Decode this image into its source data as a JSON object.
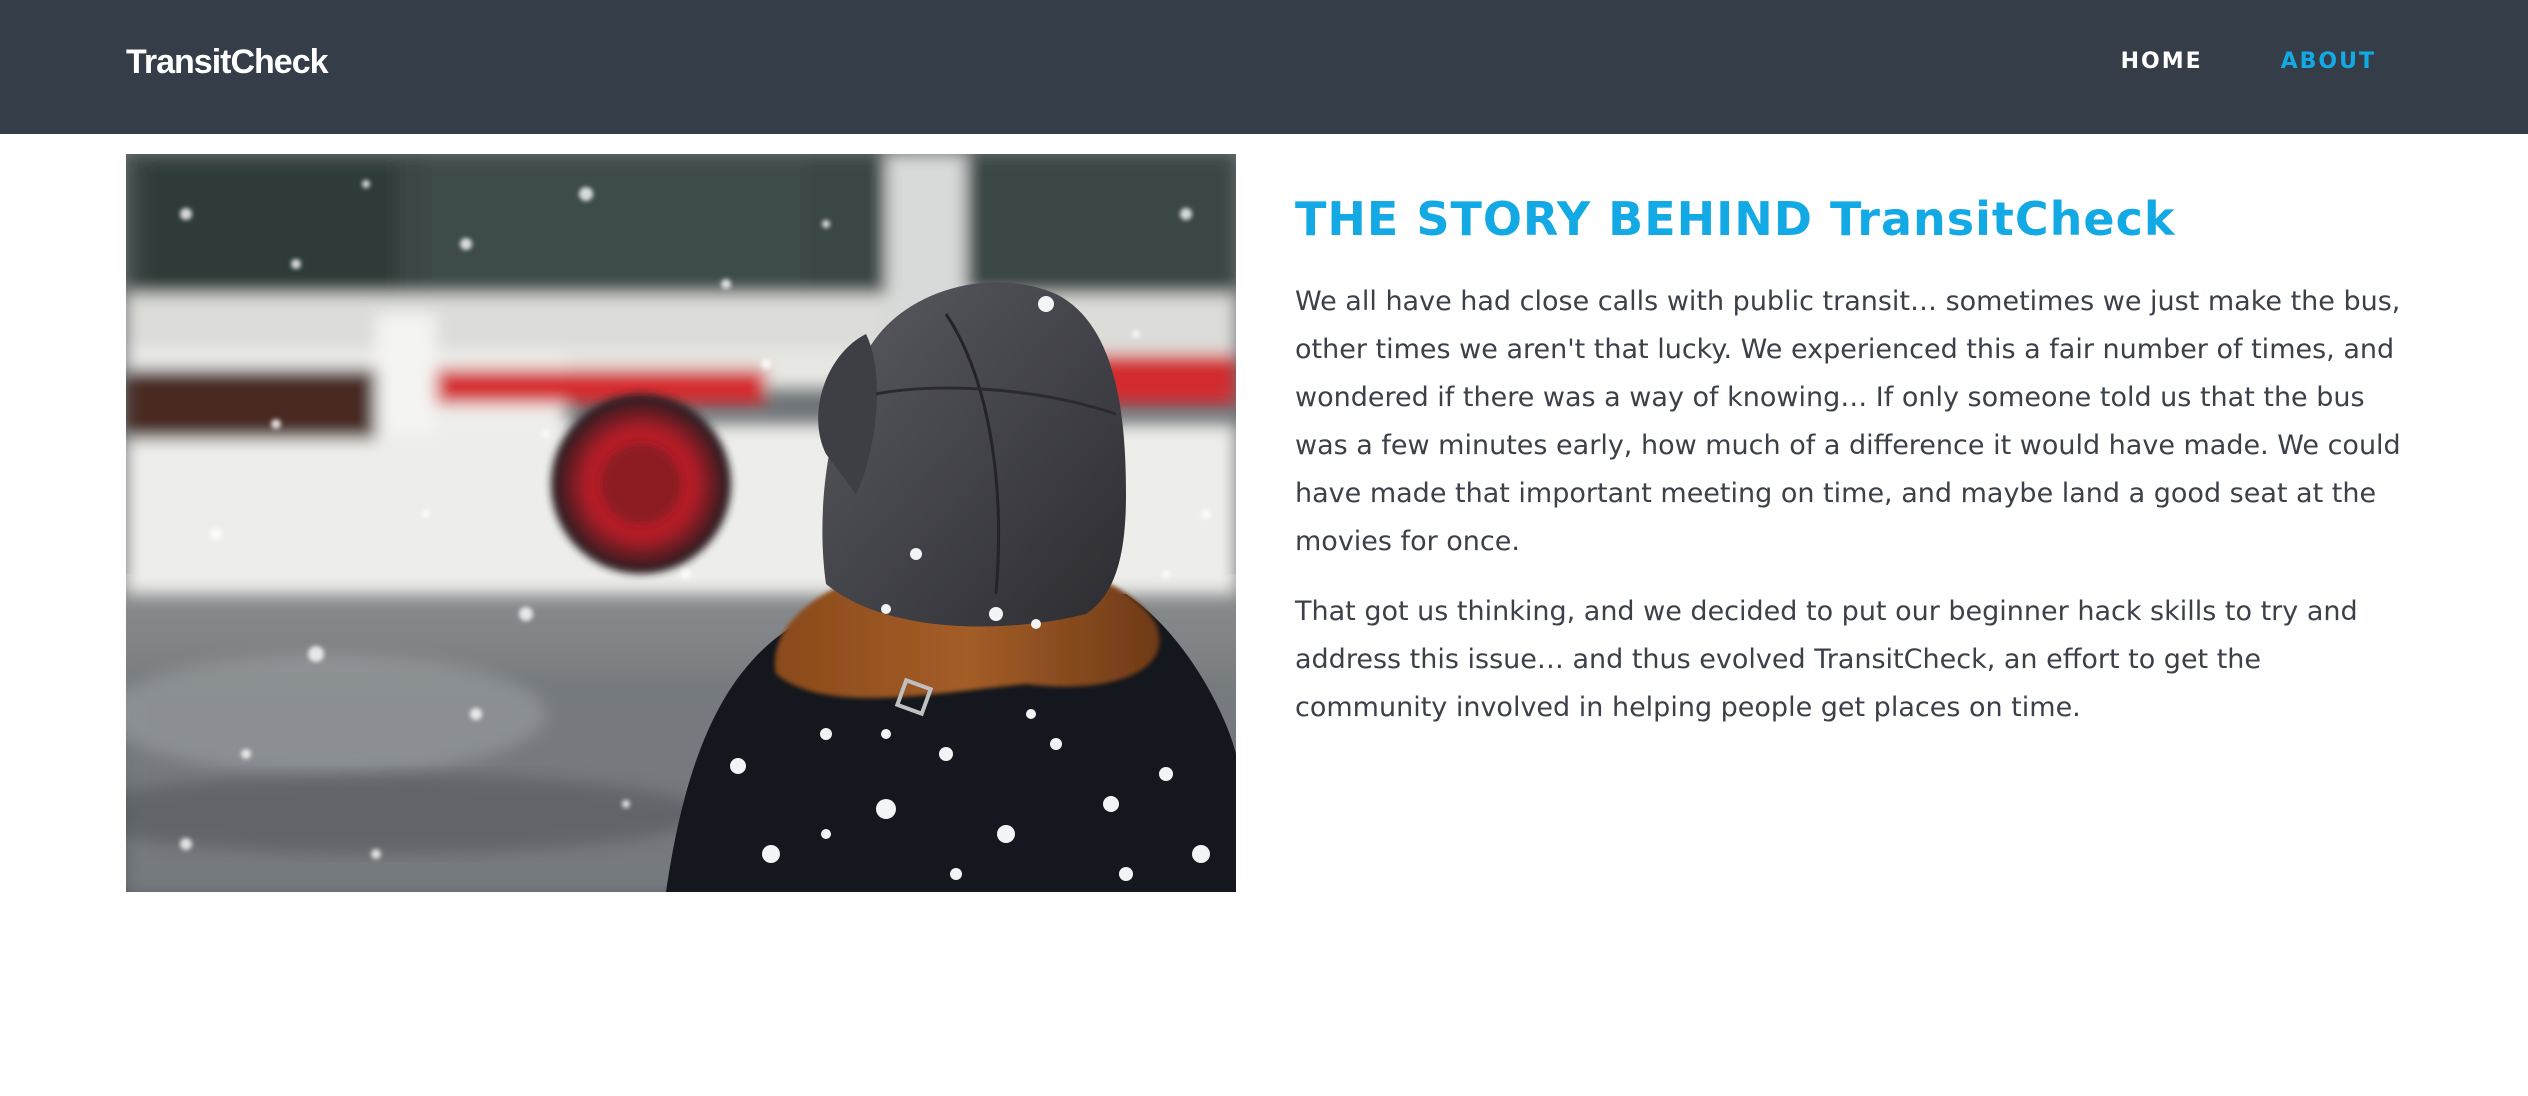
{
  "navbar": {
    "brand": "TransitCheck",
    "links": [
      {
        "label": "HOME",
        "active": false
      },
      {
        "label": "ABOUT",
        "active": true
      }
    ]
  },
  "hero": {
    "image_alt": "Person in winter hat waiting as a bus passes in the snow"
  },
  "story": {
    "title": "THE STORY BEHIND TransitCheck",
    "paragraphs": [
      "We all have had close calls with public transit… sometimes we just make the bus, other times we aren't that lucky. We experienced this a fair number of times, and wondered if there was a way of knowing… If only someone told us that the bus was a few minutes early, how much of a difference it would have made. We could have made that important meeting on time, and maybe land a good seat at the movies for once.",
      "That got us thinking, and we decided to put our beginner hack skills to try and address this issue… and thus evolved TransitCheck, an effort to get the community involved in helping people get places on time."
    ]
  },
  "colors": {
    "navbar_bg": "#353e48",
    "accent": "#12a9e5",
    "body_text": "#3b4049"
  }
}
